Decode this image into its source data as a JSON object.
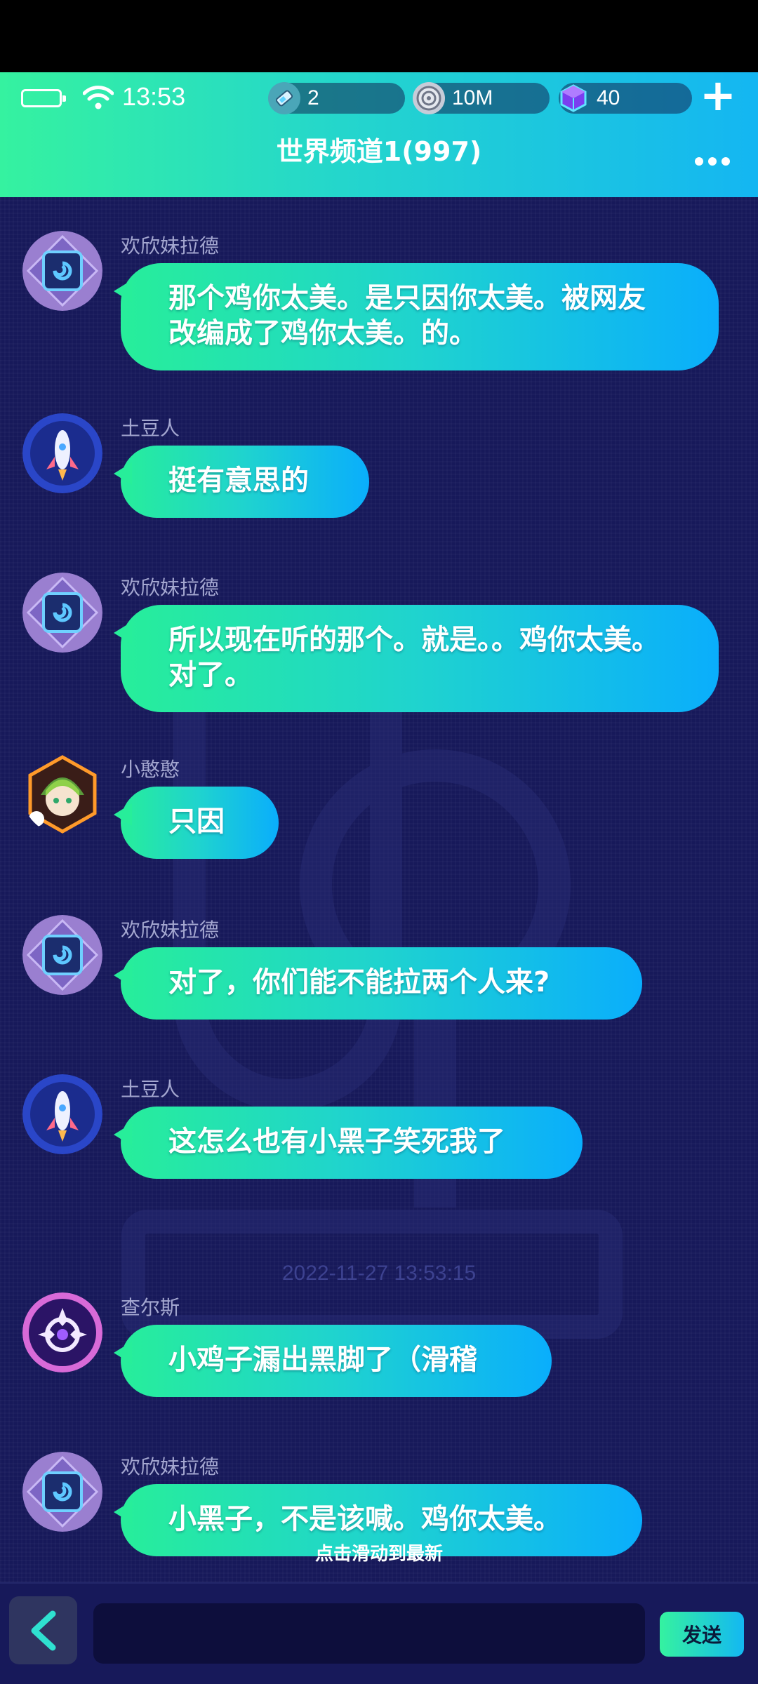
{
  "status_bar": {
    "time": "13:53"
  },
  "currencies": {
    "energy": "2",
    "coins": "10M",
    "gems": "40"
  },
  "header": {
    "title": "世界频道1(997)"
  },
  "messages": [
    {
      "sender": "欢欣妹拉德",
      "avatar": "swirl-avatar-icon",
      "lines": [
        "那个鸡你太美。是只因你太美。被网友",
        "改编成了鸡你太美。的。"
      ]
    },
    {
      "sender": "土豆人",
      "avatar": "rocket-avatar-icon",
      "lines": [
        "挺有意思的"
      ]
    },
    {
      "sender": "欢欣妹拉德",
      "avatar": "swirl-avatar-icon",
      "lines": [
        "所以现在听的那个。就是。。鸡你太美。",
        "对了。"
      ]
    },
    {
      "sender": "小憨憨",
      "avatar": "anime-girl-avatar-icon",
      "lines": [
        "只因"
      ]
    },
    {
      "sender": "欢欣妹拉德",
      "avatar": "swirl-avatar-icon",
      "lines": [
        "对了，你们能不能拉两个人来?"
      ]
    },
    {
      "sender": "土豆人",
      "avatar": "rocket-avatar-icon",
      "lines": [
        "这怎么也有小黑子笑死我了"
      ]
    },
    {
      "sender": "查尔斯",
      "avatar": "emblem-avatar-icon",
      "lines": [
        "小鸡子漏出黑脚了（滑稽"
      ]
    },
    {
      "sender": "欢欣妹拉德",
      "avatar": "swirl-avatar-icon",
      "lines": [
        "小黑子，不是该喊。鸡你太美。"
      ]
    }
  ],
  "timestamp": "2022-11-27 13:53:15",
  "scroll_hint": "点击滑动到最新",
  "input": {
    "value": "",
    "placeholder": ""
  },
  "send_label": "发送",
  "colors": {
    "header_start": "#35f2a0",
    "header_end": "#14b6f2",
    "bubble_start": "#27ee9a",
    "bubble_end": "#0aaefc",
    "chat_bg": "#17195a"
  }
}
